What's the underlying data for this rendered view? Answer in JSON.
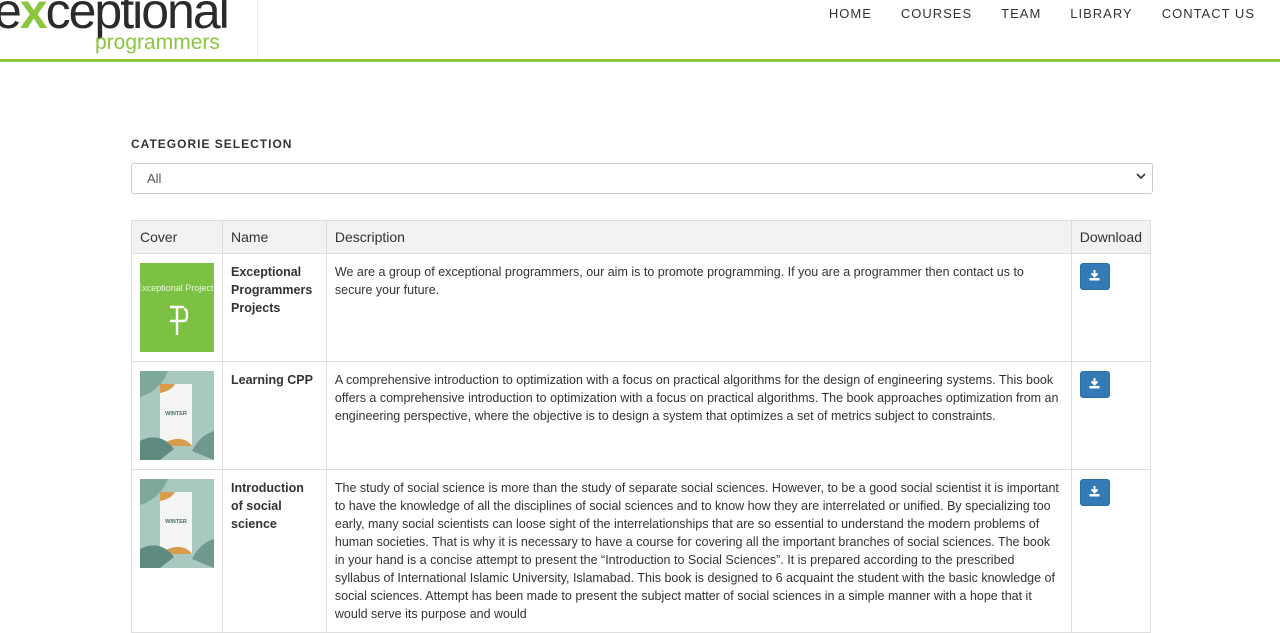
{
  "brand": {
    "main_prefix": "e",
    "main_x": "x",
    "main_suffix": "ceptional",
    "sub": "programmers"
  },
  "nav": {
    "items": [
      "HOME",
      "COURSES",
      "TEAM",
      "LIBRARY",
      "CONTACT US"
    ]
  },
  "category": {
    "label": "CATEGORIE SELECTION",
    "selected": "All"
  },
  "table": {
    "headers": [
      "Cover",
      "Name",
      "Description",
      "Download"
    ],
    "rows": [
      {
        "cover_text": "Exceptional Projects",
        "name": "Exceptional Programmers Projects",
        "description": "We are a group of exceptional programmers, our aim is to promote programming. If you are a programmer then contact us to secure your future."
      },
      {
        "cover_text": "WINTER",
        "name": "Learning CPP",
        "description": "A comprehensive introduction to optimization with a focus on practical algorithms for the design of engineering systems. This book offers a comprehensive introduction to optimization with a focus on practical algorithms. The book approaches optimization from an engineering perspective, where the objective is to design a system that optimizes a set of metrics subject to constraints."
      },
      {
        "cover_text": "WINTER",
        "name": "Introduction of social science",
        "description": "The study of social science is more than the study of separate social sciences. However, to be a good social scientist it is important to have the knowledge of all the disciplines of social sciences and to know how they are interrelated or unified. By specializing too early, many social scientists can loose sight of the interrelationships that are so essential to understand the modern problems of human societies. That is why it is necessary to have a course for covering all the important branches of social sciences. The book in your hand is a concise attempt to present the “Introduction to Social Sciences”. It is prepared according to the prescribed syllabus of International Islamic University, Islamabad. This book is designed to 6 acquaint the student with the basic knowledge of social sciences. Attempt has been made to present the subject matter of social sciences in a simple manner with a hope that it would serve its purpose and would"
      }
    ]
  },
  "colors": {
    "accent": "#8cc63f",
    "button": "#337ab7"
  }
}
